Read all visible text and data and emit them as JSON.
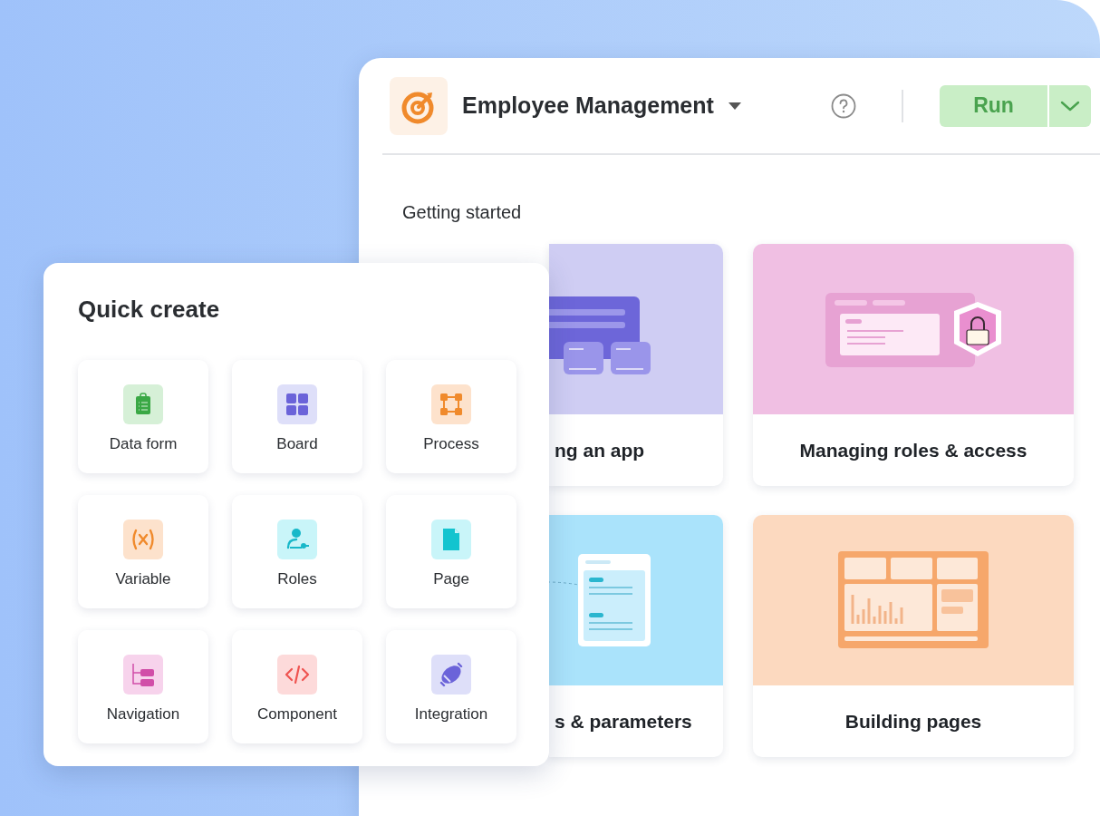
{
  "app": {
    "name": "Employee Management",
    "run_button": "Run"
  },
  "getting_started": {
    "heading": "Getting started",
    "cards": [
      {
        "title": "ng an app"
      },
      {
        "title": "Managing roles & access"
      },
      {
        "title": "s & parameters"
      },
      {
        "title": "Building pages"
      }
    ]
  },
  "quick_create": {
    "title": "Quick create",
    "items": [
      {
        "label": "Data form"
      },
      {
        "label": "Board"
      },
      {
        "label": "Process"
      },
      {
        "label": "Variable"
      },
      {
        "label": "Roles"
      },
      {
        "label": "Page"
      },
      {
        "label": "Navigation"
      },
      {
        "label": "Component"
      },
      {
        "label": "Integration"
      }
    ]
  }
}
